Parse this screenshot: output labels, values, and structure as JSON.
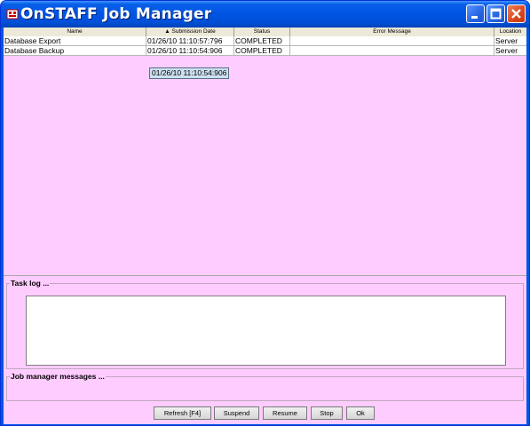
{
  "window": {
    "title": "OnSTAFF Job Manager"
  },
  "table": {
    "columns": [
      "Name",
      "Submission Date",
      "Status",
      "Error Message",
      "Location"
    ],
    "sort_indicator": "▲",
    "rows": [
      {
        "name": "Database Export",
        "date": "01/26/10 11:10:57:796",
        "status": "COMPLETED",
        "error": "",
        "location": "Server"
      },
      {
        "name": "Database Backup",
        "date": "01/26/10 11:10:54:906",
        "status": "COMPLETED",
        "error": "",
        "location": "Server"
      }
    ],
    "tooltip": "01/26/10 11:10:54:906"
  },
  "task_log": {
    "title": "Task log ..."
  },
  "messages": {
    "title": "Job manager messages ..."
  },
  "buttons": {
    "refresh": "Refresh [F4]",
    "suspend": "Suspend",
    "resume": "Resume",
    "stop": "Stop",
    "ok": "Ok"
  },
  "colors": {
    "background": "#ffccff",
    "titlebar": "#0055e5"
  }
}
